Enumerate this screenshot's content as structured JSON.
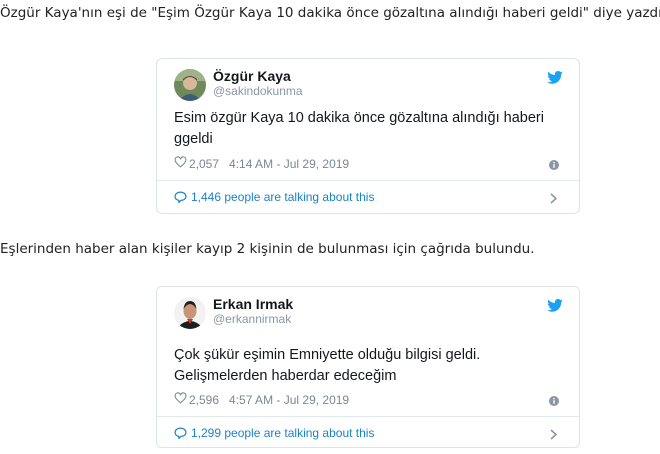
{
  "article": {
    "para1": "Özgür Kaya'nın eşi de \"Eşim Özgür Kaya 10 dakika önce gözaltına alındığı haberi geldi\" diye yazdı.",
    "para2": "Eşlerinden haber alan kişiler kayıp 2 kişinin de bulunması için çağrıda bulundu."
  },
  "tweets": [
    {
      "name": "Özgür Kaya",
      "handle": "@sakindokunma",
      "text": "Esim özgür Kaya 10 dakika önce gözaltına alındığı haberi ggeldi",
      "likes": "2,057",
      "timestamp": "4:14 AM - Jul 29, 2019",
      "talking": "1,446 people are talking about this"
    },
    {
      "name": "Erkan Irmak",
      "handle": "@erkannirmak",
      "text": "Çok şükür eşimin Emniyette olduğu bilgisi geldi. Gelişmelerden haberdar edeceğim",
      "likes": "2,596",
      "timestamp": "4:57 AM - Jul 29, 2019",
      "talking": "1,299 people are talking about this"
    }
  ],
  "icons": {
    "bird": "twitter-bird-icon",
    "heart": "heart-icon",
    "info": "info-icon",
    "talk": "comment-bubble-icon",
    "chevron": "chevron-right-icon"
  },
  "colors": {
    "brand": "#1da1f2",
    "link": "#1b82c9",
    "muted": "#7b8792"
  }
}
